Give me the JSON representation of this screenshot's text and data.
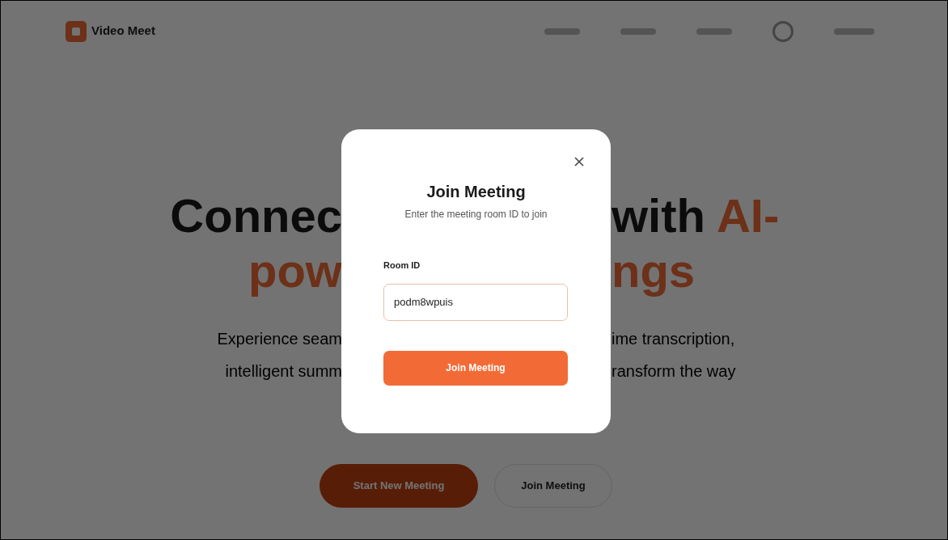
{
  "brand": {
    "name": "Video Meet"
  },
  "nav_links": [
    {
      "kind": "blurred"
    },
    {
      "kind": "blurred"
    },
    {
      "kind": "blurred"
    }
  ],
  "hero": {
    "line_1_left": "Connec",
    "line_1_right": "with ",
    "line_1_accent": "AI-",
    "line_2_left": "pow",
    "line_2_right": "ngs",
    "subtitle_left": [
      "Experience seam",
      "intelligent summ"
    ],
    "subtitle_right": [
      "ime transcription,",
      "ransform the way"
    ]
  },
  "hero_buttons": [
    {
      "label": "Start New Meeting",
      "kind": "primary"
    },
    {
      "label": "Join Meeting",
      "kind": "secondary"
    }
  ],
  "dialog": {
    "title": "Join Meeting",
    "subtitle": "Enter the meeting room ID to join",
    "field_label": "Room ID",
    "field_value": "podm8wpuis",
    "button": "Join Meeting"
  }
}
